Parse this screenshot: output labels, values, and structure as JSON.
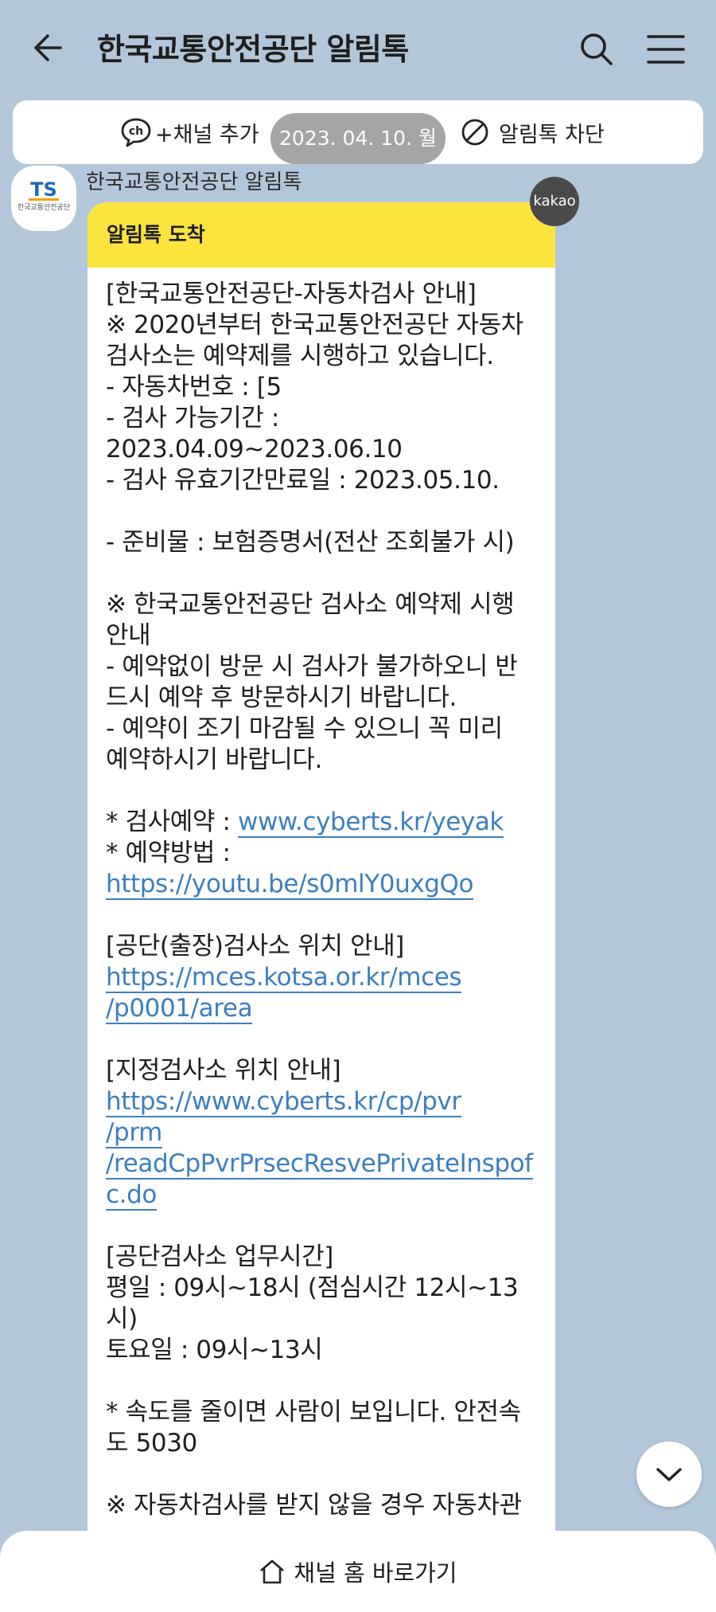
{
  "header": {
    "title": "한국교통안전공단 알림톡"
  },
  "channel_bar": {
    "add_channel_label": "+채널 추가",
    "block_label": "알림톡 차단"
  },
  "date_chip": "2023. 04. 10. 월",
  "message": {
    "sender": "한국교통안전공단 알림톡",
    "avatar_logo_text": "TS",
    "avatar_caption": "한국교통안전공단",
    "badge": "kakao",
    "header_label": "알림톡 도착",
    "lines": [
      " [한국교통안전공단-자동차검사 안내]",
      "※ 2020년부터 한국교통안전공단 자동차",
      "검사소는 예약제를 시행하고 있습니다.",
      "- 자동차번호 : [5",
      "- 검사 가능기간 :",
      "2023.04.09~2023.06.10",
      "- 검사 유효기간만료일 : 2023.05.10.",
      "",
      "- 준비물 : 보험증명서(전산 조회불가 시)",
      "",
      "※ 한국교통안전공단 검사소 예약제 시행",
      "안내",
      "- 예약없이 방문 시 검사가 불가하오니 반",
      "드시 예약 후 방문하시기 바랍니다.",
      "- 예약이 조기 마감될 수 있으니 꼭 미리",
      "예약하시기 바랍니다.",
      "",
      "* 검사예약 : ",
      "www.cyberts.kr/yeyak",
      "* 예약방법 :",
      "https://youtu.be/s0mlY0uxgQo",
      "",
      " [공단(출장)검사소 위치 안내]",
      "https://mces.kotsa.or.kr/mces",
      "/p0001/area",
      "",
      " [지정검사소 위치 안내]",
      "https://www.cyberts.kr/cp/pvr",
      "/prm",
      "/readCpPvrPrsecResvePrivateInspof",
      "c.do",
      "",
      " [공단검사소 업무시간]",
      "평일 : 09시~18시 (점심시간 12시~13",
      "시)",
      "토요일 : 09시~13시",
      "",
      "* 속도를 줄이면 사람이 보입니다. 안전속",
      "도 5030",
      "",
      "※ 자동차검사를 받지 않을 경우 자동차관"
    ]
  },
  "footer": {
    "label": "채널 홈 바로가기"
  },
  "colors": {
    "background": "#b2c7da",
    "bubble_header": "#fce43f",
    "link": "#3b7fbf"
  }
}
